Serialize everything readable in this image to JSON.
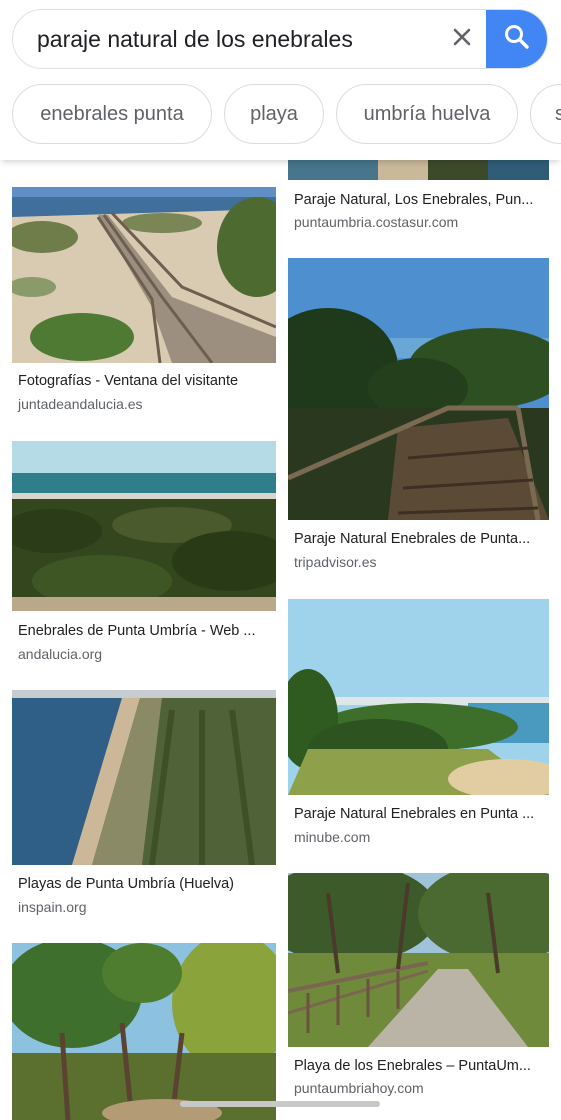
{
  "search": {
    "query": "paraje natural de los enebrales",
    "clear_icon": "close-icon",
    "search_icon": "search-icon",
    "accent_color": "#4285f4"
  },
  "chips": [
    {
      "label": "enebrales punta"
    },
    {
      "label": "playa"
    },
    {
      "label": "umbría huelva"
    },
    {
      "label": "s"
    }
  ],
  "results": {
    "left": [
      {
        "title": "Fotografías - Ventana del visitante",
        "source": "juntadeandalucia.es"
      },
      {
        "title": "Enebrales de Punta Umbría - Web ...",
        "source": "andalucia.org"
      },
      {
        "title": "Playas de Punta Umbría (Huelva)",
        "source": "inspain.org"
      }
    ],
    "right": [
      {
        "title": "Paraje Natural, Los Enebrales, Pun...",
        "source": "puntaumbria.costasur.com"
      },
      {
        "title": "Paraje Natural Enebrales de Punta...",
        "source": "tripadvisor.es"
      },
      {
        "title": "Paraje Natural Enebrales en Punta ...",
        "source": "minube.com"
      },
      {
        "title": "Playa de los Enebrales – PuntaUm...",
        "source": "puntaumbriahoy.com"
      }
    ]
  }
}
